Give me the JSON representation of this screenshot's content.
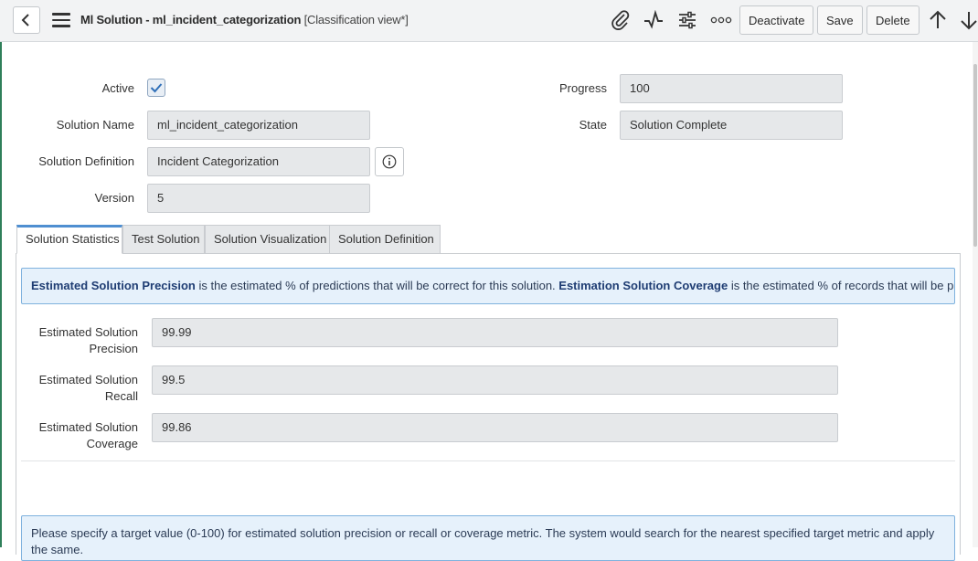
{
  "header": {
    "title": "Ml Solution - ml_incident_categorization",
    "view": "[Classification view*]",
    "icons": [
      "back-icon",
      "hamburger-icon",
      "attachment-icon",
      "activity-icon",
      "settings-sliders-icon",
      "more-icon",
      "arrow-up-icon",
      "arrow-down-icon"
    ],
    "buttons": {
      "deactivate": "Deactivate",
      "save": "Save",
      "delete": "Delete"
    }
  },
  "form": {
    "active_label": "Active",
    "active_checked": true,
    "solution_name_label": "Solution Name",
    "solution_name": "ml_incident_categorization",
    "solution_definition_label": "Solution Definition",
    "solution_definition": "Incident Categorization",
    "version_label": "Version",
    "version": "5",
    "progress_label": "Progress",
    "progress": "100",
    "state_label": "State",
    "state": "Solution Complete"
  },
  "tabs": [
    "Solution Statistics",
    "Test Solution",
    "Solution Visualization",
    "Solution Definition"
  ],
  "stats": {
    "info": {
      "precision_term": "Estimated Solution Precision",
      "precision_text": " is the estimated % of predictions that will be correct for this solution. ",
      "coverage_term": "Estimation Solution Coverage",
      "coverage_text": " is the estimated % of records that will be predicted."
    },
    "precision_label_1": "Estimated Solution",
    "precision_label_2": "Precision",
    "precision": "99.99",
    "recall_label_1": "Estimated Solution",
    "recall_label_2": "Recall",
    "recall": "99.5",
    "coverage_label_1": "Estimated Solution",
    "coverage_label_2": "Coverage",
    "coverage": "99.86",
    "target_info": "Please specify a target value (0-100) for estimated solution precision or recall or coverage metric. The system would search for the nearest specified target metric and apply the same."
  },
  "colors": {
    "accent": "#4f8fd1",
    "info_bg": "#e6f1fb",
    "info_border": "#7fb2de",
    "field_bg": "#e6e8ea"
  }
}
